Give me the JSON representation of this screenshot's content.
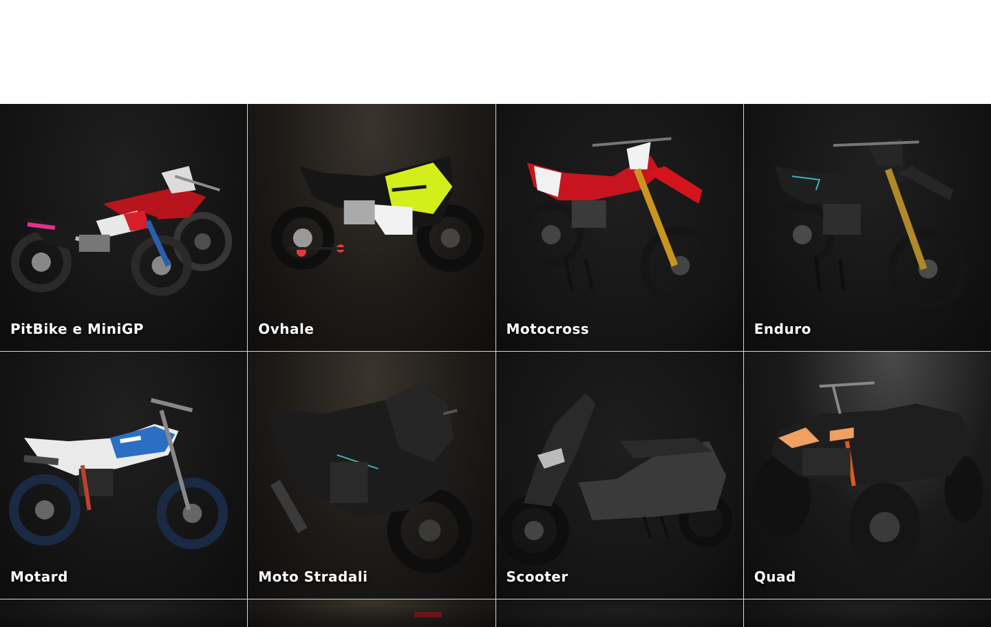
{
  "categories": [
    {
      "label": "PitBike e MiniGP",
      "icon": "pitbike-image",
      "accent": "#d81e2a"
    },
    {
      "label": "Ovhale",
      "icon": "minigp-bike-image",
      "accent": "#d4ee1c"
    },
    {
      "label": "Motocross",
      "icon": "motocross-bike-image",
      "accent": "#d4141c"
    },
    {
      "label": "Enduro",
      "icon": "enduro-bike-image",
      "accent": "#2a2a2a"
    },
    {
      "label": "Motard",
      "icon": "motard-bike-image",
      "accent": "#2a6fc4"
    },
    {
      "label": "Moto Stradali",
      "icon": "sport-bike-image",
      "accent": "#2a2a2a"
    },
    {
      "label": "Scooter",
      "icon": "scooter-image",
      "accent": "#3a3a3a"
    },
    {
      "label": "Quad",
      "icon": "quad-image",
      "accent": "#e05a1a"
    }
  ]
}
